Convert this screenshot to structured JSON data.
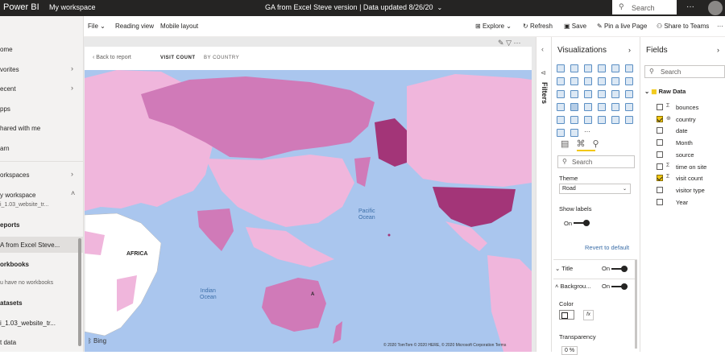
{
  "topbar": {
    "app_name": "Power BI",
    "workspace": "My workspace",
    "report_title": "GA from Excel Steve version",
    "separator": "|",
    "data_updated": "Data updated 8/26/20",
    "search_placeholder": "Search",
    "more": "···"
  },
  "nav": {
    "items": [
      {
        "label": "ome"
      },
      {
        "label": "vorites"
      },
      {
        "label": "ecent"
      },
      {
        "label": "pps"
      },
      {
        "label": "hared with me"
      },
      {
        "label": "arn"
      },
      {
        "label": "orkspaces"
      },
      {
        "label": "y workspace"
      },
      {
        "label": "i_1.03_website_tr..."
      },
      {
        "label": "eports"
      },
      {
        "label": "A from Excel Steve..."
      },
      {
        "label": "orkbooks"
      },
      {
        "label": "u have no workbooks"
      },
      {
        "label": "atasets"
      },
      {
        "label": "i_1.03_website_tr..."
      },
      {
        "label": "t data"
      }
    ]
  },
  "cmdbar": {
    "file": "File",
    "reading_view": "Reading view",
    "mobile_layout": "Mobile layout",
    "explore": "Explore",
    "refresh": "Refresh",
    "save": "Save",
    "pin": "Pin a live Page",
    "share": "Share to Teams",
    "more": "···"
  },
  "visual": {
    "back": "Back to report",
    "tab_visit_count": "VISIT COUNT",
    "tab_by_country": "BY COUNTRY",
    "labels": {
      "pacific": "Pacific\nOcean",
      "indian": "Indian\nOcean",
      "africa": "AFRICA",
      "a": "A"
    },
    "attribution": "© 2020 TomTom © 2020 HERE, © 2020 Microsoft Corporation Terms",
    "bing": "Bing"
  },
  "filters": {
    "label": "Filters"
  },
  "visualizations": {
    "title": "Visualizations",
    "search_placeholder": "Search",
    "theme_label": "Theme",
    "theme_value": "Road",
    "show_labels": "Show labels",
    "show_labels_state": "On",
    "revert": "Revert to default",
    "title_section": "Title",
    "title_state": "On",
    "background_section": "Backgrou...",
    "background_state": "On",
    "color_label": "Color",
    "fx": "fx",
    "transparency_label": "Transparency",
    "transparency_value": "0 %"
  },
  "fields": {
    "title": "Fields",
    "search_placeholder": "Search",
    "table_name": "Raw Data",
    "items": [
      {
        "name": "bounces",
        "checked": false,
        "icon": "sigma"
      },
      {
        "name": "country",
        "checked": true,
        "icon": "globe"
      },
      {
        "name": "date",
        "checked": false,
        "icon": ""
      },
      {
        "name": "Month",
        "checked": false,
        "icon": ""
      },
      {
        "name": "source",
        "checked": false,
        "icon": ""
      },
      {
        "name": "time on site",
        "checked": false,
        "icon": "sigma"
      },
      {
        "name": "visit count",
        "checked": true,
        "icon": "sigma"
      },
      {
        "name": "visitor type",
        "checked": false,
        "icon": ""
      },
      {
        "name": "Year",
        "checked": false,
        "icon": ""
      }
    ]
  },
  "colors": {
    "ocean": "#aac6ee",
    "low": "#f0b6dc",
    "mid": "#d07ab8",
    "high": "#a33578",
    "accent": "#f2c811"
  }
}
